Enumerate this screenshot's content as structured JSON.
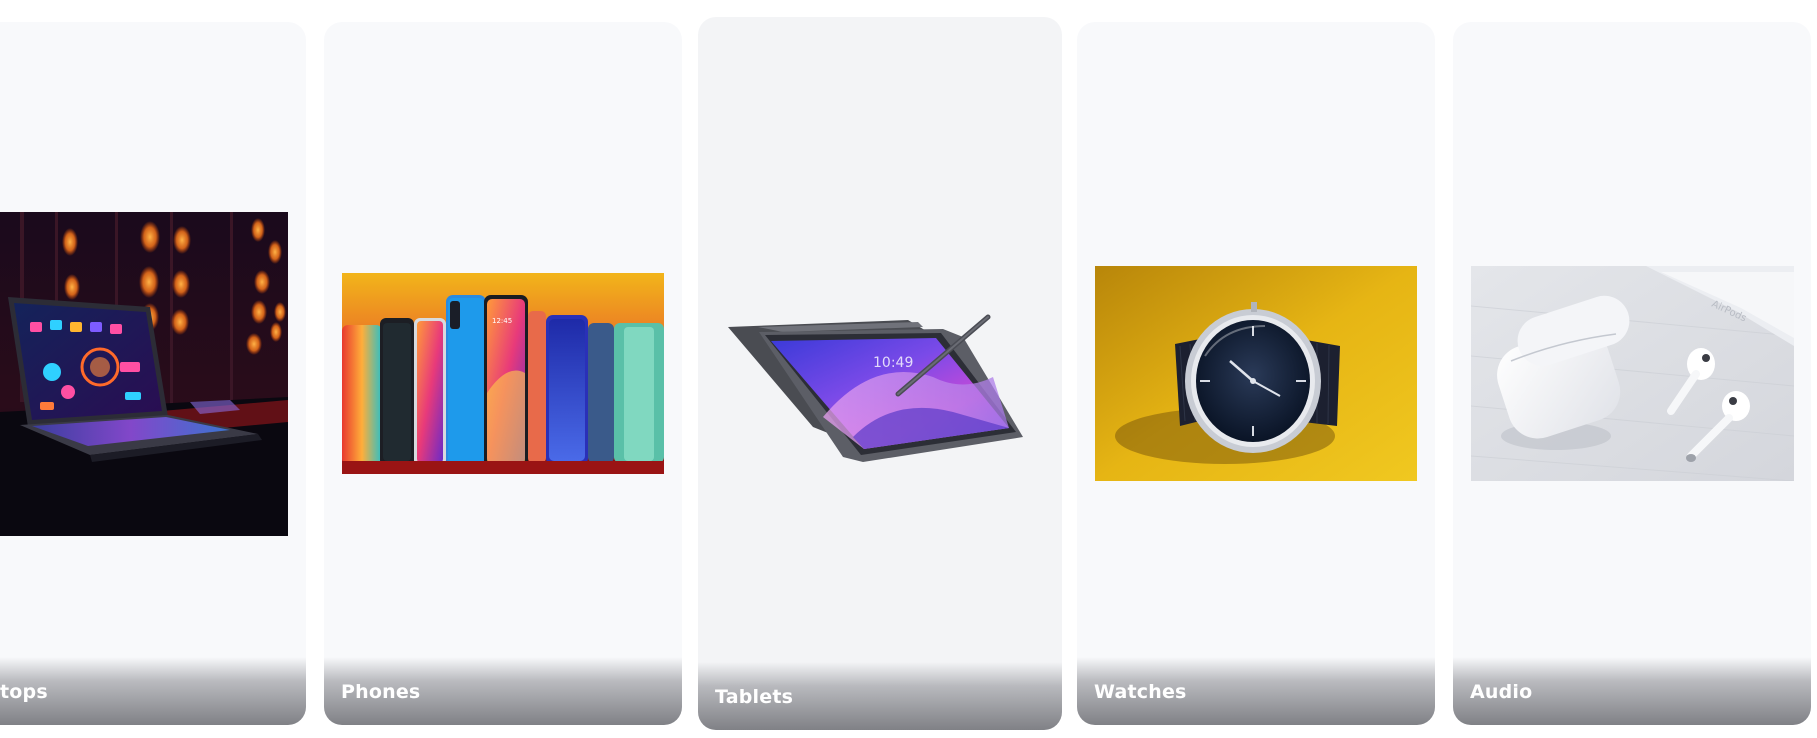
{
  "categories": [
    {
      "label": "tops",
      "image_icon": "laptop-image"
    },
    {
      "label": "Phones",
      "image_icon": "phones-image"
    },
    {
      "label": "Tablets",
      "image_icon": "tablet-image"
    },
    {
      "label": "Watches",
      "image_icon": "watch-image"
    },
    {
      "label": "Audio",
      "image_icon": "earbuds-image"
    }
  ],
  "colors": {
    "card_bg": "#f8f9fb",
    "active_card_bg": "#f3f4f6",
    "label_text": "#ffffff",
    "label_gradient_bottom": "#808186"
  }
}
